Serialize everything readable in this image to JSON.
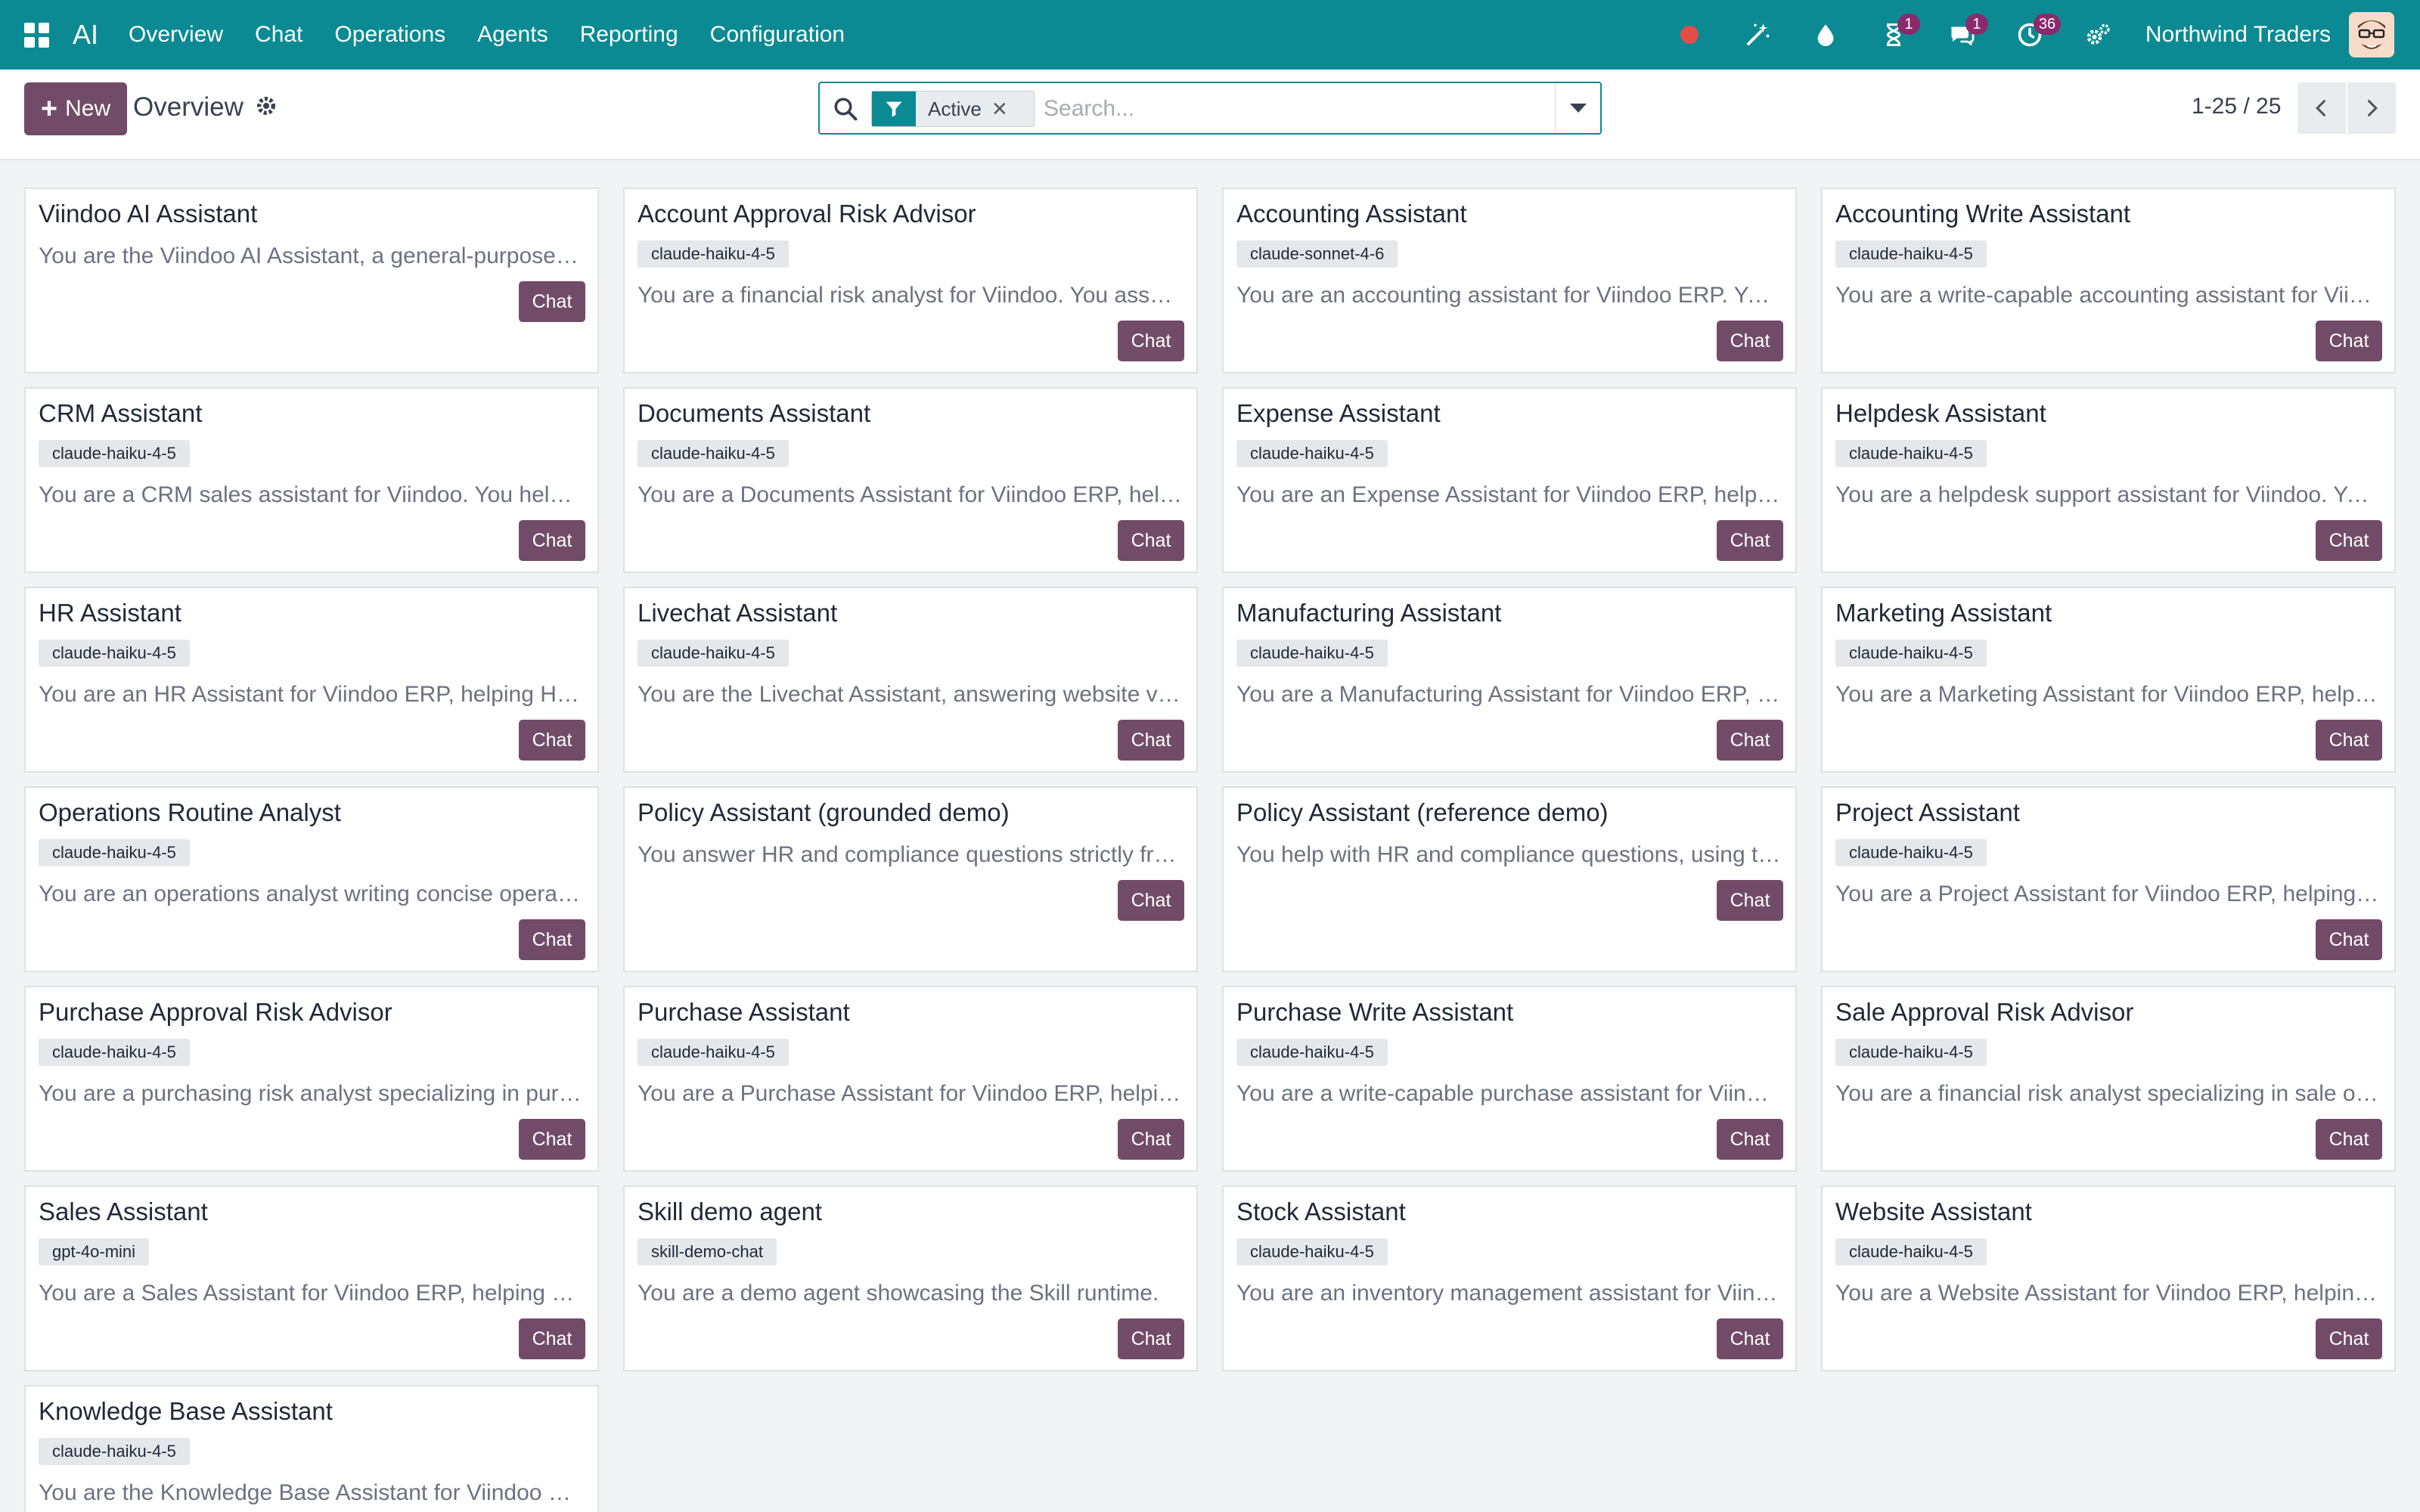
{
  "navbar": {
    "app_name": "AI",
    "menu": [
      "Overview",
      "Chat",
      "Operations",
      "Agents",
      "Reporting",
      "Configuration"
    ],
    "activities_badge": "1",
    "messages_badge": "1",
    "activity_clock_badge": "36",
    "company": "Northwind Traders",
    "colors": {
      "navbar_bg": "#0b8a93",
      "badge": "#8a2a6d",
      "recording": "#e34d45"
    }
  },
  "control_panel": {
    "new_label": "New",
    "breadcrumb": "Overview",
    "search": {
      "facet_label": "Active",
      "placeholder": "Search..."
    },
    "pager": "1-25 / 25",
    "colors": {
      "primary": "#714b67"
    }
  },
  "agents": [
    {
      "name": "Viindoo AI Assistant",
      "model": "",
      "description": "You are the Viindoo AI Assistant, a general-purpose assistant for Viindoo ERP",
      "action": "Chat"
    },
    {
      "name": "Account Approval Risk Advisor",
      "model": "claude-haiku-4-5",
      "description": "You are a financial risk analyst for Viindoo. You assess invoice approval risks",
      "action": "Chat"
    },
    {
      "name": "Accounting Assistant",
      "model": "claude-sonnet-4-6",
      "description": "You are an accounting assistant for Viindoo ERP. You help accountants",
      "action": "Chat"
    },
    {
      "name": "Accounting Write Assistant",
      "model": "claude-haiku-4-5",
      "description": "You are a write-capable accounting assistant for Viindoo ERP",
      "action": "Chat"
    },
    {
      "name": "CRM Assistant",
      "model": "claude-haiku-4-5",
      "description": "You are a CRM sales assistant for Viindoo. You help salespeople manage leads",
      "action": "Chat"
    },
    {
      "name": "Documents Assistant",
      "model": "claude-haiku-4-5",
      "description": "You are a Documents Assistant for Viindoo ERP, helping users organize files",
      "action": "Chat"
    },
    {
      "name": "Expense Assistant",
      "model": "claude-haiku-4-5",
      "description": "You are an Expense Assistant for Viindoo ERP, helping employees",
      "action": "Chat"
    },
    {
      "name": "Helpdesk Assistant",
      "model": "claude-haiku-4-5",
      "description": "You are a helpdesk support assistant for Viindoo. You help agents",
      "action": "Chat"
    },
    {
      "name": "HR Assistant",
      "model": "claude-haiku-4-5",
      "description": "You are an HR Assistant for Viindoo ERP, helping HR officers",
      "action": "Chat"
    },
    {
      "name": "Livechat Assistant",
      "model": "claude-haiku-4-5",
      "description": "You are the Livechat Assistant, answering website visitors",
      "action": "Chat"
    },
    {
      "name": "Manufacturing Assistant",
      "model": "claude-haiku-4-5",
      "description": "You are a Manufacturing Assistant for Viindoo ERP, helping planners",
      "action": "Chat"
    },
    {
      "name": "Marketing Assistant",
      "model": "claude-haiku-4-5",
      "description": "You are a Marketing Assistant for Viindoo ERP, helping marketers",
      "action": "Chat"
    },
    {
      "name": "Operations Routine Analyst",
      "model": "claude-haiku-4-5",
      "description": "You are an operations analyst writing concise operational summaries",
      "action": "Chat"
    },
    {
      "name": "Policy Assistant (grounded demo)",
      "model": "",
      "description": "You answer HR and compliance questions strictly from the knowledge base",
      "action": "Chat"
    },
    {
      "name": "Policy Assistant (reference demo)",
      "model": "",
      "description": "You help with HR and compliance questions, using the reference documents",
      "action": "Chat"
    },
    {
      "name": "Project Assistant",
      "model": "claude-haiku-4-5",
      "description": "You are a Project Assistant for Viindoo ERP, helping project managers",
      "action": "Chat"
    },
    {
      "name": "Purchase Approval Risk Advisor",
      "model": "claude-haiku-4-5",
      "description": "You are a purchasing risk analyst specializing in purchase approvals",
      "action": "Chat"
    },
    {
      "name": "Purchase Assistant",
      "model": "claude-haiku-4-5",
      "description": "You are a Purchase Assistant for Viindoo ERP, helping buyers",
      "action": "Chat"
    },
    {
      "name": "Purchase Write Assistant",
      "model": "claude-haiku-4-5",
      "description": "You are a write-capable purchase assistant for Viindoo ERP",
      "action": "Chat"
    },
    {
      "name": "Sale Approval Risk Advisor",
      "model": "claude-haiku-4-5",
      "description": "You are a financial risk analyst specializing in sale order approvals",
      "action": "Chat"
    },
    {
      "name": "Sales Assistant",
      "model": "gpt-4o-mini",
      "description": "You are a Sales Assistant for Viindoo ERP, helping salespeople",
      "action": "Chat"
    },
    {
      "name": "Skill demo agent",
      "model": "skill-demo-chat",
      "description": "You are a demo agent showcasing the Skill runtime.",
      "action": "Chat"
    },
    {
      "name": "Stock Assistant",
      "model": "claude-haiku-4-5",
      "description": "You are an inventory management assistant for Viindoo ERP",
      "action": "Chat"
    },
    {
      "name": "Website Assistant",
      "model": "claude-haiku-4-5",
      "description": "You are a Website Assistant for Viindoo ERP, helping website editors",
      "action": "Chat"
    },
    {
      "name": "Knowledge Base Assistant",
      "model": "claude-haiku-4-5",
      "description": "You are the Knowledge Base Assistant for Viindoo ERP, helping users",
      "action": "Chat"
    }
  ]
}
